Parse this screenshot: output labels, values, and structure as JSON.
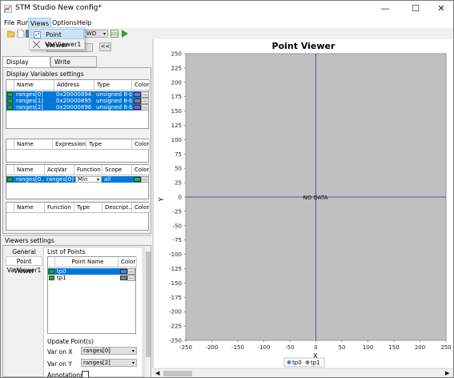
{
  "window": {
    "title": "STM Studio New config*",
    "minimize": "—",
    "maximize": "☐",
    "close": "✕"
  },
  "menu": {
    "file": "File",
    "run": "Run",
    "views": "Views",
    "options": "Options",
    "help": "Help"
  },
  "views_menu": {
    "items": [
      {
        "label": "Point Viewer"
      },
      {
        "label": "VarViewer1"
      }
    ]
  },
  "toolbar": {
    "mode_label": "WD",
    "nav_back": "<<"
  },
  "left_tabs": {
    "display": "Display Variables",
    "write": "Write Variables"
  },
  "display_settings": {
    "title": "Display Variables settings",
    "var_table": {
      "headers": [
        "Name",
        "Address",
        "Type",
        "Color"
      ],
      "rows": [
        {
          "name": "ranges[0]",
          "address": "0x20000894",
          "type": "unsigned 8-bit",
          "color": "#5b7fd6"
        },
        {
          "name": "ranges[1]",
          "address": "0x20000895",
          "type": "unsigned 8-bit",
          "color": "#808080"
        },
        {
          "name": "ranges[2]",
          "address": "0x20000896",
          "type": "unsigned 8-bit",
          "color": "#9a4fd0"
        }
      ]
    },
    "expr_table": {
      "headers": [
        "Name",
        "Expression",
        "Type",
        "Color"
      ]
    },
    "acq_table": {
      "headers": [
        "Name",
        "AcqVar",
        "Function",
        "Scope",
        "Color"
      ],
      "rows": [
        {
          "name": "ranges[0...",
          "acqvar": "ranges[0]",
          "function": "Min",
          "scope": "all",
          "color": "#20c020"
        }
      ]
    },
    "func_table": {
      "headers": [
        "Name",
        "Function",
        "Type",
        "Descript...",
        "Color"
      ]
    }
  },
  "viewers_settings": {
    "title": "Viewers settings",
    "list": [
      "General",
      "Point Viewer",
      "VarViewer1"
    ],
    "points_group": "List of Points",
    "points_table": {
      "headers": [
        "Point Name",
        "Color"
      ],
      "rows": [
        {
          "name": "tp0",
          "color": "#5b7fd6"
        },
        {
          "name": "tp1",
          "color": "#808080"
        }
      ]
    },
    "update_group": "Update Point(s)",
    "var_x_label": "Var on X",
    "var_x_value": "ranges[0]",
    "var_y_label": "Var on Y",
    "var_y_value": "ranges[2]",
    "annotations_label": "Annotations"
  },
  "chart_data": {
    "type": "scatter",
    "title": "Point Viewer",
    "xlabel": "X",
    "ylabel": "Y",
    "xlim": [
      -250,
      250
    ],
    "ylim": [
      -250,
      250
    ],
    "xticks": [
      -250,
      -200,
      -150,
      -100,
      -50,
      0,
      50,
      100,
      150,
      200,
      250
    ],
    "yticks": [
      250,
      225,
      200,
      175,
      150,
      125,
      100,
      75,
      50,
      25,
      0,
      -25,
      -50,
      -75,
      -100,
      -125,
      -150,
      -175,
      -200,
      -225,
      -250
    ],
    "series": [
      {
        "name": "tp0",
        "values": [],
        "color": "#5b7fd6"
      },
      {
        "name": "tp1",
        "values": [],
        "color": "#808080"
      }
    ],
    "no_data_text": "NO DATA",
    "legend_position": "bottom"
  }
}
